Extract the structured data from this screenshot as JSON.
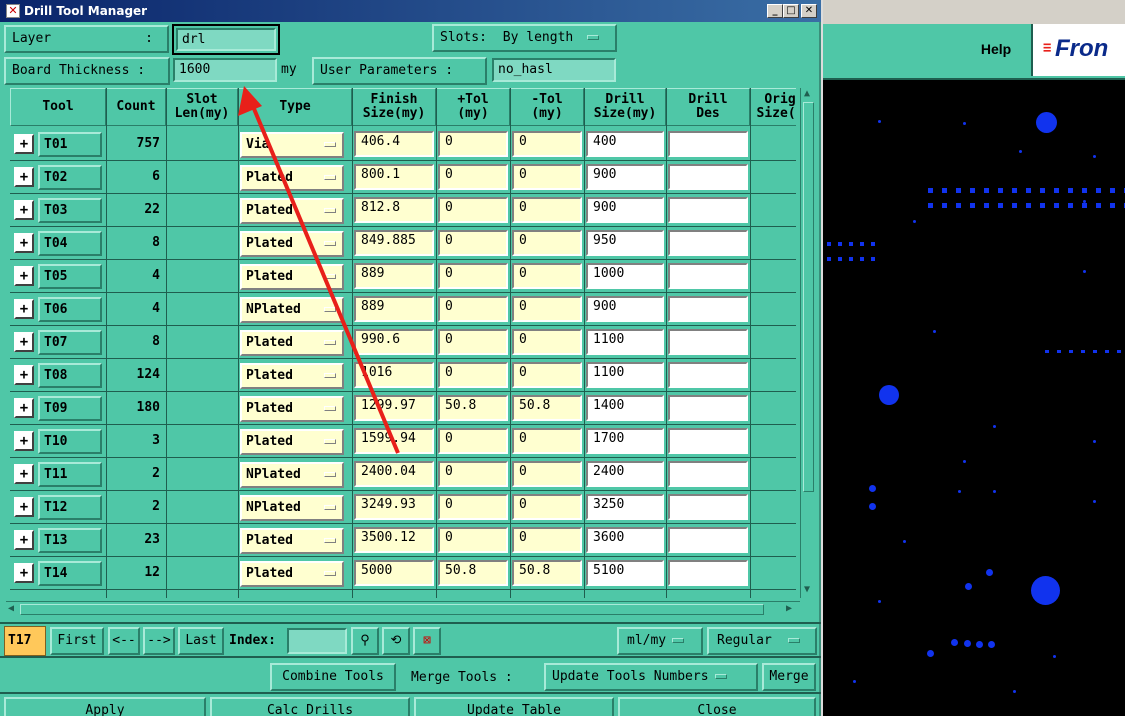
{
  "window": {
    "title": "Drill Tool Manager"
  },
  "top_controls": {
    "layer_label": "Layer",
    "layer_colon": ":",
    "layer_value": "drl",
    "slots_label": "Slots:",
    "slots_value": "By length",
    "board_thickness_label": "Board Thickness :",
    "board_thickness_value": "1600",
    "board_thickness_unit": "my",
    "user_params_label": "User Parameters :",
    "user_params_value": "no_hasl"
  },
  "table": {
    "headers": [
      "Tool",
      "Count",
      "Slot\nLen(my)",
      "Type",
      "Finish\nSize(my)",
      "+Tol\n(my)",
      "-Tol\n(my)",
      "Drill\nSize(my)",
      "Drill\nDes",
      "Orig\nSize(m"
    ],
    "rows": [
      {
        "tool": "T01",
        "count": "757",
        "type": "Via",
        "finish": "406.4",
        "ptol": "0",
        "ntol": "0",
        "drill": "400",
        "des": ""
      },
      {
        "tool": "T02",
        "count": "6",
        "type": "Plated",
        "finish": "800.1",
        "ptol": "0",
        "ntol": "0",
        "drill": "900",
        "des": ""
      },
      {
        "tool": "T03",
        "count": "22",
        "type": "Plated",
        "finish": "812.8",
        "ptol": "0",
        "ntol": "0",
        "drill": "900",
        "des": ""
      },
      {
        "tool": "T04",
        "count": "8",
        "type": "Plated",
        "finish": "849.885",
        "ptol": "0",
        "ntol": "0",
        "drill": "950",
        "des": ""
      },
      {
        "tool": "T05",
        "count": "4",
        "type": "Plated",
        "finish": "889",
        "ptol": "0",
        "ntol": "0",
        "drill": "1000",
        "des": ""
      },
      {
        "tool": "T06",
        "count": "4",
        "type": "NPlated",
        "finish": "889",
        "ptol": "0",
        "ntol": "0",
        "drill": "900",
        "des": ""
      },
      {
        "tool": "T07",
        "count": "8",
        "type": "Plated",
        "finish": "990.6",
        "ptol": "0",
        "ntol": "0",
        "drill": "1100",
        "des": ""
      },
      {
        "tool": "T08",
        "count": "124",
        "type": "Plated",
        "finish": "1016",
        "ptol": "0",
        "ntol": "0",
        "drill": "1100",
        "des": ""
      },
      {
        "tool": "T09",
        "count": "180",
        "type": "Plated",
        "finish": "1299.97",
        "ptol": "50.8",
        "ntol": "50.8",
        "drill": "1400",
        "des": ""
      },
      {
        "tool": "T10",
        "count": "3",
        "type": "Plated",
        "finish": "1599.94",
        "ptol": "0",
        "ntol": "0",
        "drill": "1700",
        "des": ""
      },
      {
        "tool": "T11",
        "count": "2",
        "type": "NPlated",
        "finish": "2400.04",
        "ptol": "0",
        "ntol": "0",
        "drill": "2400",
        "des": ""
      },
      {
        "tool": "T12",
        "count": "2",
        "type": "NPlated",
        "finish": "3249.93",
        "ptol": "0",
        "ntol": "0",
        "drill": "3250",
        "des": ""
      },
      {
        "tool": "T13",
        "count": "23",
        "type": "Plated",
        "finish": "3500.12",
        "ptol": "0",
        "ntol": "0",
        "drill": "3600",
        "des": ""
      },
      {
        "tool": "T14",
        "count": "12",
        "type": "Plated",
        "finish": "5000",
        "ptol": "50.8",
        "ntol": "50.8",
        "drill": "5100",
        "des": ""
      }
    ]
  },
  "nav": {
    "current_tool": "T17",
    "first": "First",
    "prev": "<--",
    "next": "-->",
    "last": "Last",
    "index_label": "Index:",
    "index_value": "",
    "units_value": "ml/my",
    "mode_value": "Regular"
  },
  "merge_bar": {
    "combine": "Combine Tools",
    "merge_label": "Merge Tools :",
    "merge_option": "Update Tools Numbers",
    "merge_btn": "Merge"
  },
  "actions": {
    "apply": "Apply",
    "calc": "Calc Drills",
    "update": "Update Table",
    "close": "Close"
  },
  "right_panel": {
    "help": "Help",
    "logo": "Fron"
  },
  "colors": {
    "dialog_bg": "#4fc7a7",
    "input_bg": "#ffffd0",
    "canvas_bg": "#000000",
    "pad": "#1133ee",
    "annotation_arrow": "#e8201a"
  }
}
